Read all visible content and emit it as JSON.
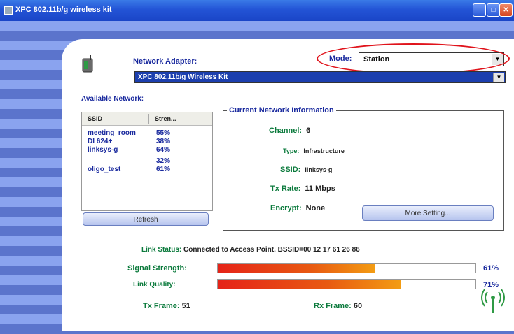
{
  "window": {
    "title": "XPC 802.11b/g wireless kit"
  },
  "header": {
    "adapter_label": "Network Adapter:",
    "adapter_value": "XPC 802.11b/g Wireless Kit",
    "mode_label": "Mode:",
    "mode_value": "Station"
  },
  "networks": {
    "label": "Available Network:",
    "columns": [
      "SSID",
      "Stren..."
    ],
    "rows": [
      {
        "ssid": "meeting_room",
        "strength": "55%"
      },
      {
        "ssid": "DI 624+",
        "strength": "38%"
      },
      {
        "ssid": "linksys-g",
        "strength": "64%"
      },
      {
        "ssid": "",
        "strength": "32%"
      },
      {
        "ssid": "oligo_test",
        "strength": "61%"
      }
    ],
    "refresh_label": "Refresh"
  },
  "current": {
    "title": "Current Network Information",
    "channel_label": "Channel:",
    "channel_value": "6",
    "type_label": "Type:",
    "type_value": "Infrastructure",
    "ssid_label": "SSID:",
    "ssid_value": "linksys-g",
    "txrate_label": "Tx Rate:",
    "txrate_value": "11 Mbps",
    "encrypt_label": "Encrypt:",
    "encrypt_value": "None",
    "more_label": "More Setting..."
  },
  "status": {
    "link_status_label": "Link Status:",
    "link_status_value": "Connected to Access Point. BSSID=00 12 17 61 26 86",
    "signal_label": "Signal Strength:",
    "signal_pct": "61%",
    "signal_level": 0.61,
    "quality_label": "Link Quality:",
    "quality_pct": "71%",
    "quality_level": 0.71,
    "tx_label": "Tx Frame:",
    "tx_value": "51",
    "rx_label": "Rx Frame:",
    "rx_value": "60"
  },
  "colors": {
    "accent": "#1a2a9e",
    "label_green": "#0b7a3c",
    "highlight": "#e0131b"
  },
  "icons": [
    "adapter-icon",
    "wireless-signal-icon"
  ]
}
